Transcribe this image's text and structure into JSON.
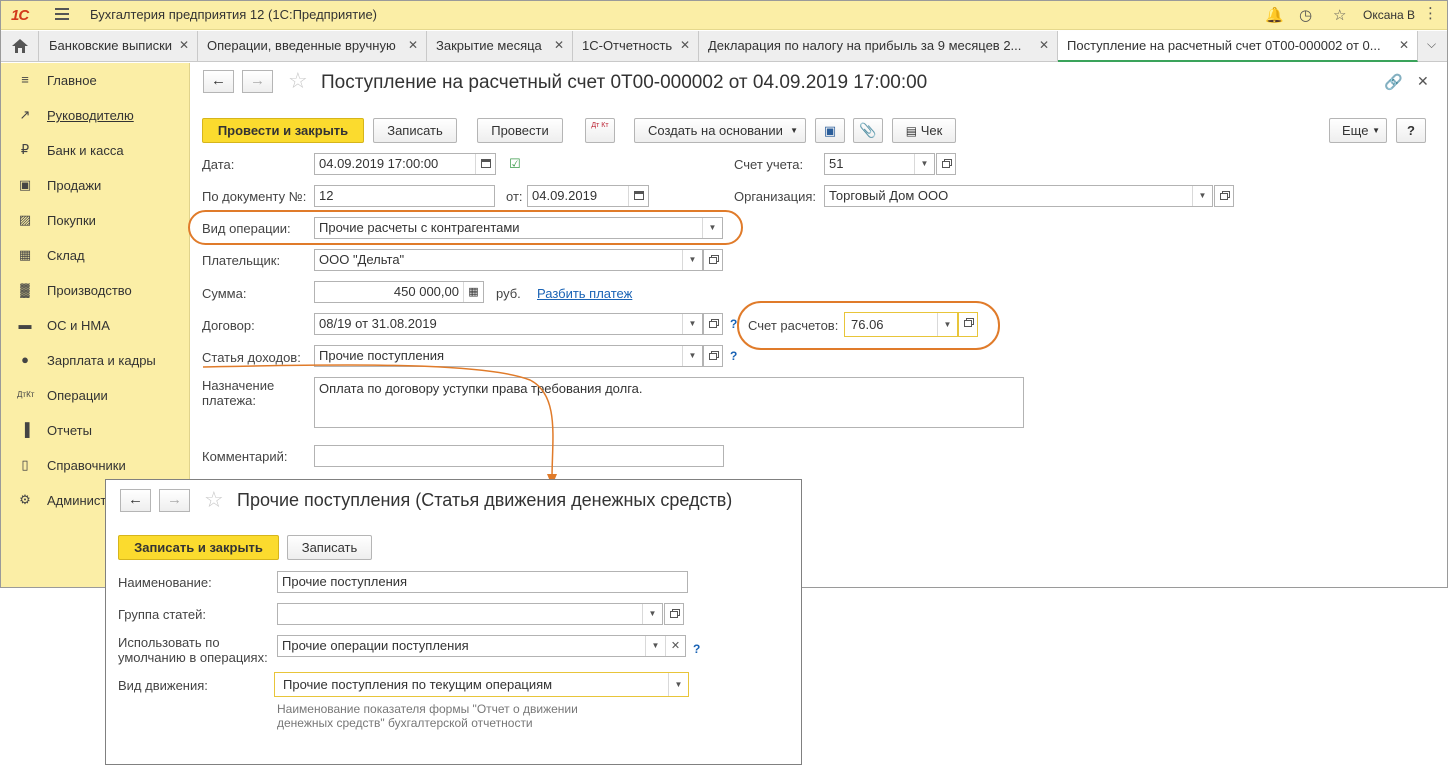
{
  "titlebar": {
    "logo": "1С",
    "app_title": "Бухгалтерия предприятия 12  (1С:Предприятие)",
    "user": "Оксана В"
  },
  "tabs": [
    {
      "label": "Банковские выписки"
    },
    {
      "label": "Операции, введенные вручную"
    },
    {
      "label": "Закрытие месяца"
    },
    {
      "label": "1С-Отчетность"
    },
    {
      "label": "Декларация по налогу на прибыль за 9 месяцев 2..."
    },
    {
      "label": "Поступление на расчетный счет 0Т00-000002 от 0..."
    }
  ],
  "sidebar": {
    "items": [
      {
        "label": "Главное"
      },
      {
        "label": "Руководителю"
      },
      {
        "label": "Банк и касса"
      },
      {
        "label": "Продажи"
      },
      {
        "label": "Покупки"
      },
      {
        "label": "Склад"
      },
      {
        "label": "Производство"
      },
      {
        "label": "ОС и НМА"
      },
      {
        "label": "Зарплата и кадры"
      },
      {
        "label": "Операции"
      },
      {
        "label": "Отчеты"
      },
      {
        "label": "Справочники"
      },
      {
        "label": "Админист"
      }
    ]
  },
  "doc": {
    "title": "Поступление на расчетный счет 0Т00-000002 от 04.09.2019 17:00:00",
    "toolbar": {
      "post_close": "Провести и закрыть",
      "save": "Записать",
      "post": "Провести",
      "dtkt": "Дт Кт",
      "create_based": "Создать на основании",
      "check": "Чек",
      "more": "Еще",
      "help": "?"
    },
    "fields": {
      "date_label": "Дата:",
      "date_value": "04.09.2019 17:00:00",
      "account_label": "Счет учета:",
      "account_value": "51",
      "docnum_label": "По документу №:",
      "docnum_value": "12",
      "from_label": "от:",
      "from_value": "04.09.2019",
      "org_label": "Организация:",
      "org_value": "Торговый Дом ООО",
      "optype_label": "Вид операции:",
      "optype_value": "Прочие расчеты с контрагентами",
      "payer_label": "Плательщик:",
      "payer_value": "ООО \"Дельта\"",
      "sum_label": "Сумма:",
      "sum_value": "450 000,00",
      "currency": "руб.",
      "split_link": "Разбить платеж",
      "contract_label": "Договор:",
      "contract_value": "08/19 от 31.08.2019",
      "settle_label": "Счет расчетов:",
      "settle_value": "76.06",
      "income_label": "Статья доходов:",
      "income_value": "Прочие поступления",
      "purpose_label": "Назначение платежа:",
      "purpose_value": "Оплата по договору уступки права требования долга.",
      "comment_label": "Комментарий:",
      "comment_value": ""
    }
  },
  "popup": {
    "title": "Прочие поступления (Статья движения денежных средств)",
    "save_close": "Записать и закрыть",
    "save": "Записать",
    "name_label": "Наименование:",
    "name_value": "Прочие поступления",
    "group_label": "Группа статей:",
    "group_value": "",
    "default_label": "Использовать по умолчанию в операциях:",
    "default_value": "Прочие операции поступления",
    "movement_label": "Вид движения:",
    "movement_value": "Прочие поступления по текущим операциям",
    "hint": "Наименование показателя формы \"Отчет о движении денежных средств\" бухгалтерской отчетности"
  },
  "colors": {
    "accent_yellow": "#fbdb2e",
    "panel_yellow": "#fbeea6",
    "annotation_orange": "#e07b2a",
    "link_blue": "#1a63b5"
  }
}
